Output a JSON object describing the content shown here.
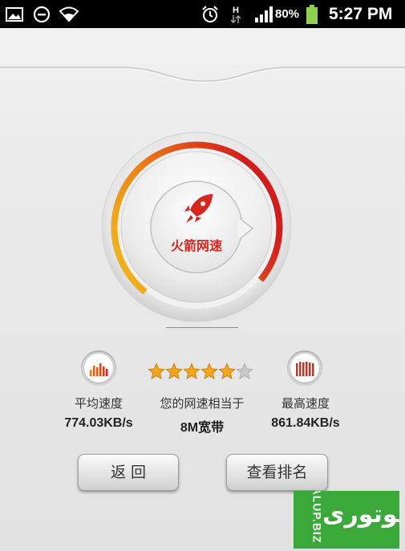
{
  "status_bar": {
    "battery_percent": "80%",
    "network_type": "H",
    "time": "5:27 PM",
    "icons": [
      "gallery-icon",
      "do-not-disturb-icon",
      "wifi-icon",
      "alarm-icon",
      "data-arrows-icon",
      "signal-icon",
      "battery-icon"
    ]
  },
  "gauge": {
    "brand_label": "火箭网速",
    "center_icon": "rocket-icon",
    "colors": {
      "arc_start": "#f2c11c",
      "arc_mid": "#ef7a16",
      "arc_end": "#d21d1d",
      "brand": "#d8261f"
    }
  },
  "stats": {
    "average": {
      "label": "平均速度",
      "value": "774.03KB/s",
      "icon": "average-speed-icon"
    },
    "equivalent": {
      "label": "您的网速相当于",
      "value": "8M宽带",
      "rating": 5,
      "rating_max": 6
    },
    "maximum": {
      "label": "最高速度",
      "value": "861.84KB/s",
      "icon": "max-speed-icon"
    }
  },
  "buttons": {
    "back_label": "返 回",
    "ranking_label": "查看排名"
  },
  "watermark": {
    "vertical_text": "ALUP.BIZ",
    "logo_text": "الوتوری"
  }
}
